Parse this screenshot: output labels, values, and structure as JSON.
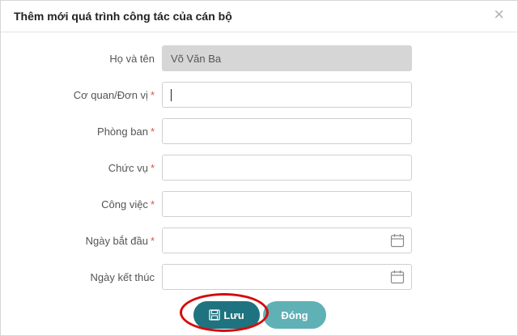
{
  "dialog": {
    "title": "Thêm mới quá trình công tác của cán bộ",
    "close_symbol": "×"
  },
  "required_marker": "*",
  "fields": [
    {
      "label": "Họ và tên",
      "value": "Võ Văn Ba",
      "required": false,
      "disabled": true
    },
    {
      "label": "Cơ quan/Đơn vị",
      "value": "",
      "required": true,
      "focused": true
    },
    {
      "label": "Phòng ban",
      "value": "",
      "required": true
    },
    {
      "label": "Chức vụ",
      "value": "",
      "required": true
    },
    {
      "label": "Công việc",
      "value": "",
      "required": true
    },
    {
      "label": "Ngày bắt đầu",
      "value": "",
      "required": true,
      "icon": "calendar-icon"
    },
    {
      "label": "Ngày kết thúc",
      "value": "",
      "required": false,
      "icon": "calendar-icon"
    }
  ],
  "buttons": {
    "save_label": "Lưu",
    "save_icon": "floppy-disk-icon",
    "close_label": "Đóng"
  },
  "colors": {
    "save_button": "#1f7380",
    "close_button": "#5fb1b5",
    "required": "#d9534f",
    "highlight": "#d40c0c",
    "disabled_input": "#d6d6d6"
  }
}
